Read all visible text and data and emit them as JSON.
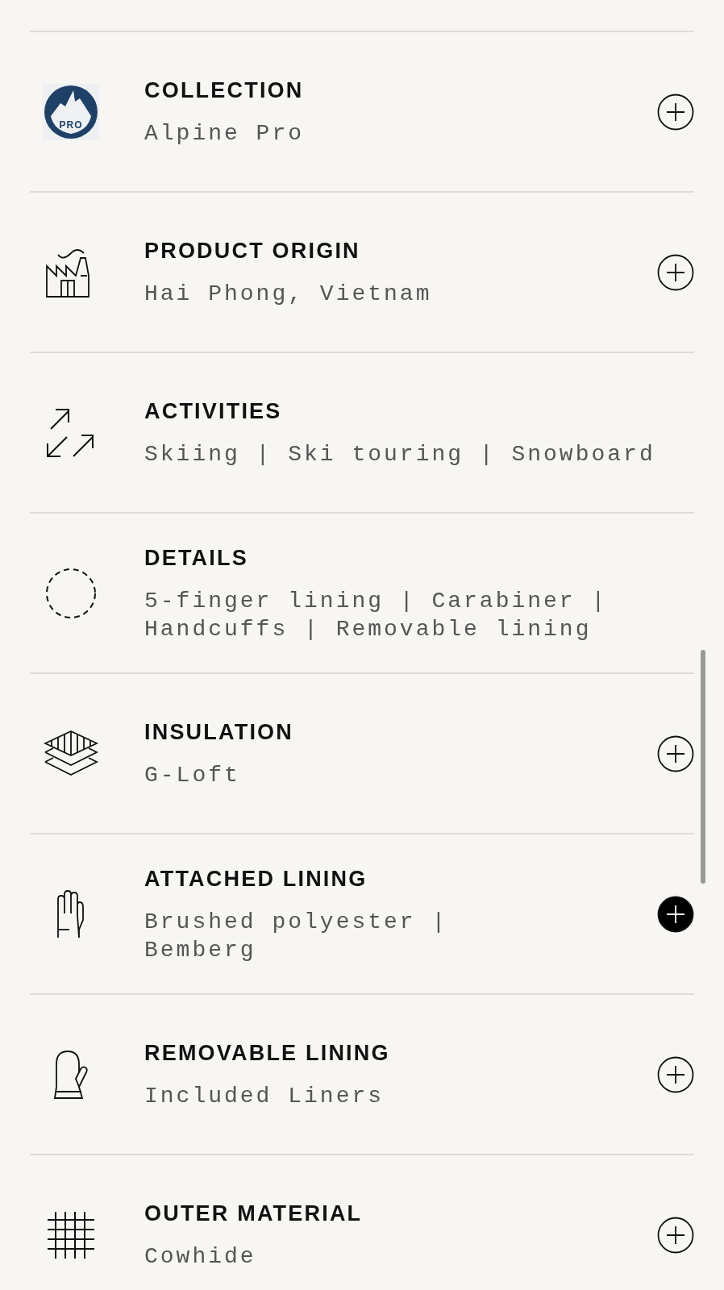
{
  "specs": [
    {
      "title": "COLLECTION",
      "value": "Alpine Pro",
      "icon_label": "PRO",
      "expand_button": true,
      "highlighted": false
    },
    {
      "title": "PRODUCT ORIGIN",
      "value": "Hai Phong, Vietnam",
      "expand_button": true,
      "highlighted": false
    },
    {
      "title": "ACTIVITIES",
      "value": "Skiing | Ski touring | Snowboard",
      "expand_button": false
    },
    {
      "title": "DETAILS",
      "value": "5-finger lining | Carabiner | Handcuffs | Removable lining",
      "expand_button": false
    },
    {
      "title": "INSULATION",
      "value": "G-Loft",
      "expand_button": true,
      "highlighted": false
    },
    {
      "title": "ATTACHED LINING",
      "value": "Brushed polyester | Bemberg",
      "expand_button": true,
      "highlighted": true
    },
    {
      "title": "REMOVABLE LINING",
      "value": "Included Liners",
      "expand_button": true,
      "highlighted": false
    },
    {
      "title": "OUTER MATERIAL",
      "value": "Cowhide",
      "expand_button": true,
      "highlighted": false
    }
  ]
}
